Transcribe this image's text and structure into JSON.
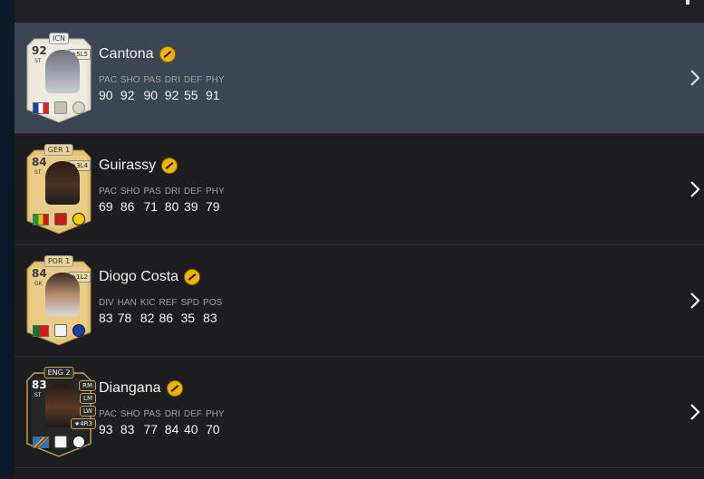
{
  "colors": {
    "background": "#1b1b1d",
    "row_selected": "#3b4554",
    "evo_badge": "#f0b400",
    "gold_card": "#e3c27a",
    "icon_card": "#e9e4d8"
  },
  "players": [
    {
      "name": "Cantona",
      "rating": "92",
      "position": "ST",
      "card_tag": "ICN",
      "chem_style": "★5L5",
      "selected": true,
      "card_style": "icon",
      "stats": [
        {
          "label": "PAC",
          "value": "90"
        },
        {
          "label": "SHO",
          "value": "92"
        },
        {
          "label": "PAS",
          "value": "90"
        },
        {
          "label": "DRI",
          "value": "92"
        },
        {
          "label": "DEF",
          "value": "55"
        },
        {
          "label": "PHY",
          "value": "91"
        }
      ],
      "alt_positions": []
    },
    {
      "name": "Guirassy",
      "rating": "84",
      "position": "ST",
      "card_tag": "GER 1",
      "chem_style": "★3L4",
      "selected": false,
      "card_style": "gold",
      "stats": [
        {
          "label": "PAC",
          "value": "69"
        },
        {
          "label": "SHO",
          "value": "86"
        },
        {
          "label": "PAS",
          "value": "71"
        },
        {
          "label": "DRI",
          "value": "80"
        },
        {
          "label": "DEF",
          "value": "39"
        },
        {
          "label": "PHY",
          "value": "79"
        }
      ],
      "alt_positions": []
    },
    {
      "name": "Diogo Costa",
      "rating": "84",
      "position": "GK",
      "card_tag": "POR 1",
      "chem_style": "★1L2",
      "selected": false,
      "card_style": "gold",
      "stats": [
        {
          "label": "DIV",
          "value": "83"
        },
        {
          "label": "HAN",
          "value": "78"
        },
        {
          "label": "KIC",
          "value": "82"
        },
        {
          "label": "REF",
          "value": "86"
        },
        {
          "label": "SPD",
          "value": "35"
        },
        {
          "label": "POS",
          "value": "83"
        }
      ],
      "alt_positions": []
    },
    {
      "name": "Diangana",
      "rating": "83",
      "position": "ST",
      "card_tag": "ENG 2",
      "chem_style": "★4R3",
      "selected": false,
      "card_style": "black",
      "stats": [
        {
          "label": "PAC",
          "value": "93"
        },
        {
          "label": "SHO",
          "value": "83"
        },
        {
          "label": "PAS",
          "value": "77"
        },
        {
          "label": "DRI",
          "value": "84"
        },
        {
          "label": "DEF",
          "value": "40"
        },
        {
          "label": "PHY",
          "value": "70"
        }
      ],
      "alt_positions": [
        "RM",
        "LM",
        "LW"
      ]
    }
  ]
}
